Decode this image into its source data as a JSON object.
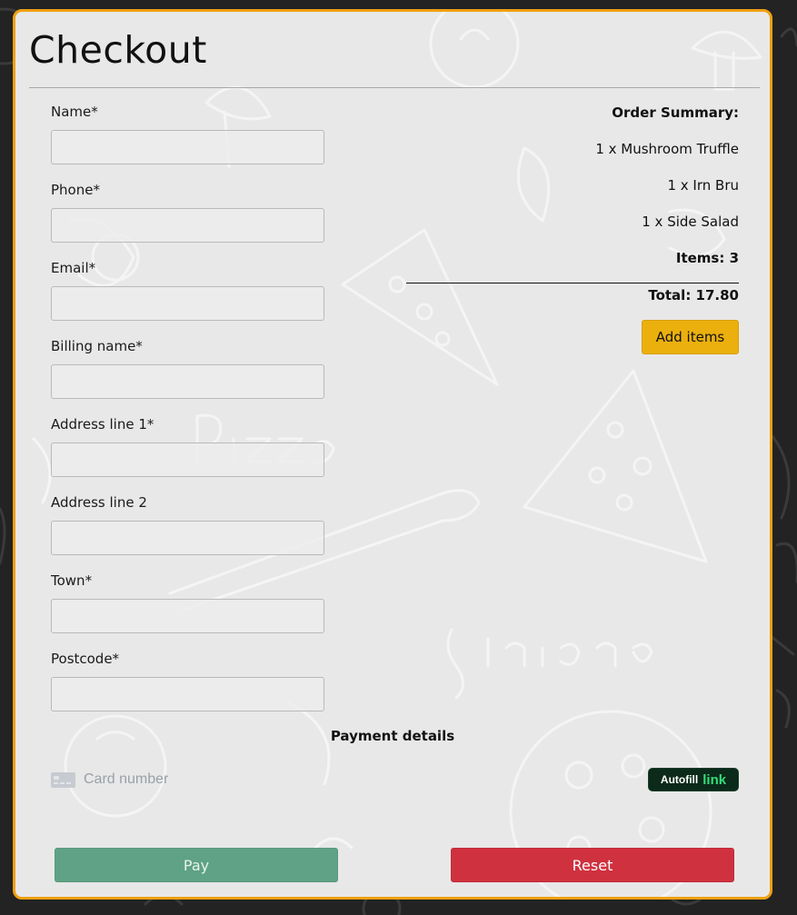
{
  "page": {
    "title": "Checkout"
  },
  "form": {
    "fields": [
      {
        "label": "Name*",
        "value": "",
        "placeholder": ""
      },
      {
        "label": "Phone*",
        "value": "",
        "placeholder": ""
      },
      {
        "label": "Email*",
        "value": "",
        "placeholder": ""
      },
      {
        "label": "Billing name*",
        "value": "",
        "placeholder": ""
      },
      {
        "label": "Address line 1*",
        "value": "",
        "placeholder": ""
      },
      {
        "label": "Address line 2",
        "value": "",
        "placeholder": ""
      },
      {
        "label": "Town*",
        "value": "",
        "placeholder": ""
      },
      {
        "label": "Postcode*",
        "value": "",
        "placeholder": ""
      }
    ]
  },
  "summary": {
    "heading": "Order Summary:",
    "items": [
      "1 x Mushroom Truffle",
      "1 x Irn Bru",
      "1 x Side Salad"
    ],
    "items_count": "Items: 3",
    "total": "Total: 17.80",
    "add_items_label": "Add items"
  },
  "payment": {
    "heading": "Payment details",
    "card_placeholder": "Card number",
    "card_icon": "credit-card-icon",
    "autofill_label": "Autofill",
    "autofill_link": "link"
  },
  "actions": {
    "pay_label": "Pay",
    "reset_label": "Reset"
  },
  "colors": {
    "background": "#232323",
    "panel": "#e8e8e8",
    "panel_border": "#f0a010",
    "add_items": "#ebb00e",
    "pay": "#5fa285",
    "reset": "#d0313f",
    "autofill_bg": "#0b2a1a",
    "autofill_link": "#33dd7a"
  }
}
